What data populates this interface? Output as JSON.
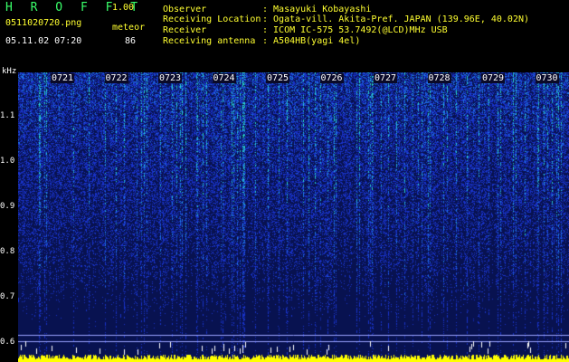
{
  "header": {
    "app_title": "H R O F F T",
    "app_version": "1.00",
    "file_name": "0511020720.png",
    "mode": "meteor",
    "date_time": "05.11.02 07:20",
    "count": "86"
  },
  "info": {
    "observer_key": "Observer",
    "observer_val": ": Masayuki Kobayashi",
    "location_key": "Receiving Location",
    "location_val": ": Ogata-vill. Akita-Pref. JAPAN (139.96E, 40.02N)",
    "receiver_key": "Receiver",
    "receiver_val": ": ICOM IC-575 53.7492(@LCD)MHz USB",
    "antenna_key": "Receiving antenna",
    "antenna_val": ": A504HB(yagi 4el)"
  },
  "axis": {
    "unit": "kHz",
    "y_ticks": [
      "1.1",
      "1.0",
      "0.9",
      "0.8",
      "0.7",
      "0.6"
    ],
    "y_values": [
      1.1,
      1.0,
      0.9,
      0.8,
      0.7,
      0.6
    ],
    "time_labels": [
      "0721",
      "0722",
      "0723",
      "0724",
      "0725",
      "0726",
      "0727",
      "0728",
      "0729",
      "0730"
    ]
  },
  "colors": {
    "background": "#000000",
    "title_green": "#39ff6a",
    "label_yellow": "#ffff30",
    "spectrum_low": "#08103a",
    "spectrum_mid": "#1e3cd2",
    "spectrum_high": "#2ad7c8",
    "level_bar": "#ffff00"
  }
}
